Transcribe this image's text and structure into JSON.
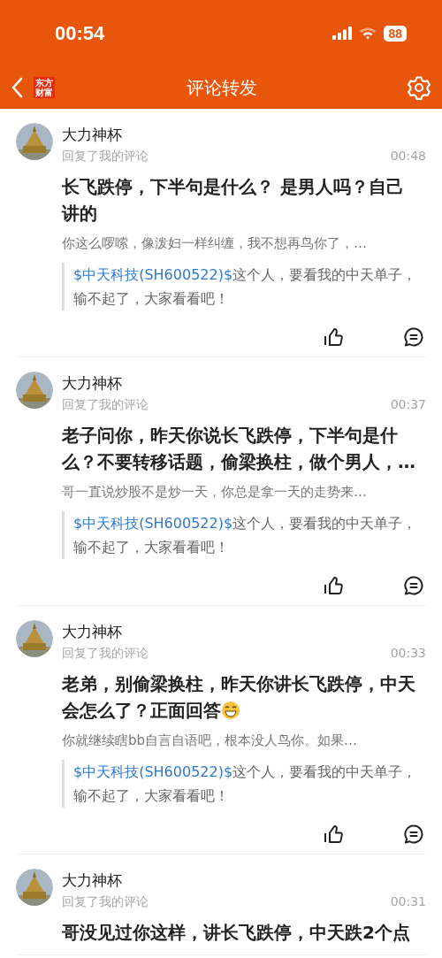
{
  "status_bar": {
    "time": "00:54",
    "battery": "88"
  },
  "nav": {
    "logo_lines": [
      "东方",
      "财富"
    ],
    "title": "评论转发"
  },
  "comments": [
    {
      "author": "大力神杯",
      "action": "回复了我的评论",
      "time": "00:48",
      "text": "长飞跌停，下半句是什么？ 是男人吗？自己讲的",
      "reply": "你这么啰嗦，像泼妇一样纠缠，我不想再鸟你了，…",
      "quote_link": "$中天科技(SH600522)$",
      "quote_text": "这个人，要看我的中天单子，输不起了，大家看看吧！"
    },
    {
      "author": "大力神杯",
      "action": "回复了我的评论",
      "time": "00:37",
      "text": "老子问你，昨天你说长飞跌停，下半句是什么？不要转移话题，偷梁换柱，做个男人，…",
      "reply": "哥一直说炒股不是炒一天，你总是拿一天的走势来…",
      "quote_link": "$中天科技(SH600522)$",
      "quote_text": "这个人，要看我的中天单子，输不起了，大家看看吧！"
    },
    {
      "author": "大力神杯",
      "action": "回复了我的评论",
      "time": "00:33",
      "text": "老弟，别偷梁换柱，昨天你讲长飞跌停，中天会怎么了？正面回答",
      "emoji": true,
      "reply": "你就继续瞎bb自言自语吧，根本没人鸟你。如果…",
      "quote_link": "$中天科技(SH600522)$",
      "quote_text": "这个人，要看我的中天单子，输不起了，大家看看吧！"
    },
    {
      "author": "大力神杯",
      "action": "回复了我的评论",
      "time": "00:31",
      "text": "哥没见过你这样，讲长飞跌停，中天跌2个点"
    }
  ]
}
